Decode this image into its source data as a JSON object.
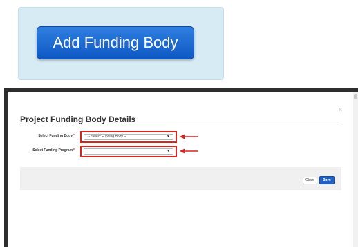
{
  "callout": {
    "button_label": "Add Funding Body"
  },
  "modal": {
    "title": "Project Funding Body Details",
    "close_glyph": "×",
    "required_mark": "*",
    "fields": [
      {
        "label": "Select Funding Body",
        "value": "-- Select Funding Body --"
      },
      {
        "label": "Select Funding Program",
        "value": ""
      }
    ],
    "close_button": "Close",
    "save_button": "Save"
  },
  "colors": {
    "highlight": "#d9231d",
    "primary_button": "#1f62c7",
    "callout_bg": "#d7ebf5"
  },
  "icons": {
    "dropdown": "caret-down-icon",
    "annotation": "red-arrow-icon"
  }
}
